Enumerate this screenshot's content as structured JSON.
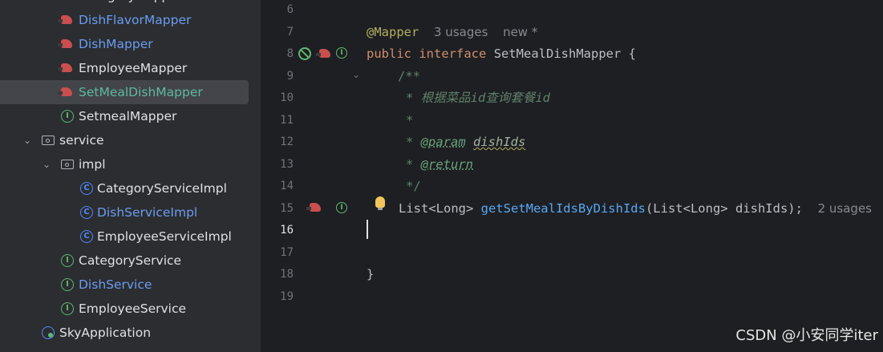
{
  "tree": {
    "items": [
      {
        "label": "CategoryMapper",
        "type": "mapper",
        "color": "default"
      },
      {
        "label": "DishFlavorMapper",
        "type": "mapper",
        "color": "blue"
      },
      {
        "label": "DishMapper",
        "type": "mapper",
        "color": "blue"
      },
      {
        "label": "EmployeeMapper",
        "type": "mapper",
        "color": "default"
      },
      {
        "label": "SetMealDishMapper",
        "type": "mapper",
        "color": "green",
        "selected": true
      },
      {
        "label": "SetmealMapper",
        "type": "interface",
        "color": "default"
      },
      {
        "label": "service",
        "type": "folder",
        "color": "default",
        "expanded": true
      },
      {
        "label": "impl",
        "type": "folder",
        "color": "default",
        "expanded": true
      },
      {
        "label": "CategoryServiceImpl",
        "type": "class",
        "color": "default"
      },
      {
        "label": "DishServiceImpl",
        "type": "class",
        "color": "blue"
      },
      {
        "label": "EmployeeServiceImpl",
        "type": "class",
        "color": "default"
      },
      {
        "label": "CategoryService",
        "type": "interface",
        "color": "default"
      },
      {
        "label": "DishService",
        "type": "interface",
        "color": "blue"
      },
      {
        "label": "EmployeeService",
        "type": "interface",
        "color": "default"
      },
      {
        "label": "SkyApplication",
        "type": "app",
        "color": "default"
      }
    ]
  },
  "editor": {
    "line_numbers": [
      "6",
      "7",
      "8",
      "9",
      "10",
      "11",
      "12",
      "13",
      "14",
      "15",
      "16",
      "17",
      "18",
      "19"
    ],
    "current_line": "16",
    "code": {
      "l7_annotation": "@Mapper",
      "l7_usages": "3 usages",
      "l7_new": "new *",
      "l8_public": "public",
      "l8_interface": "interface",
      "l8_name": "SetMealDishMapper {",
      "l9": "/**",
      "l10": "* 根据菜品id查询套餐id",
      "l11": "*",
      "l12_star": "* ",
      "l12_tag": "@param",
      "l12_param": "dishIds",
      "l13_star": "* ",
      "l13_tag": "@return",
      "l14": "*/",
      "l15_type": "List<Long> ",
      "l15_method": "getSetMealIdsByDishIds",
      "l15_args": "(List<Long> dishIds);",
      "l15_usages": "2 usages",
      "l18": "}"
    }
  },
  "watermark": "CSDN @小安同学iter",
  "colors": {
    "background": "#1e1f22",
    "tree_background": "#2b2d30",
    "keyword": "#cf8e6d",
    "method": "#56a8f5",
    "doc_comment": "#5f826b",
    "annotation": "#b3ae60"
  }
}
